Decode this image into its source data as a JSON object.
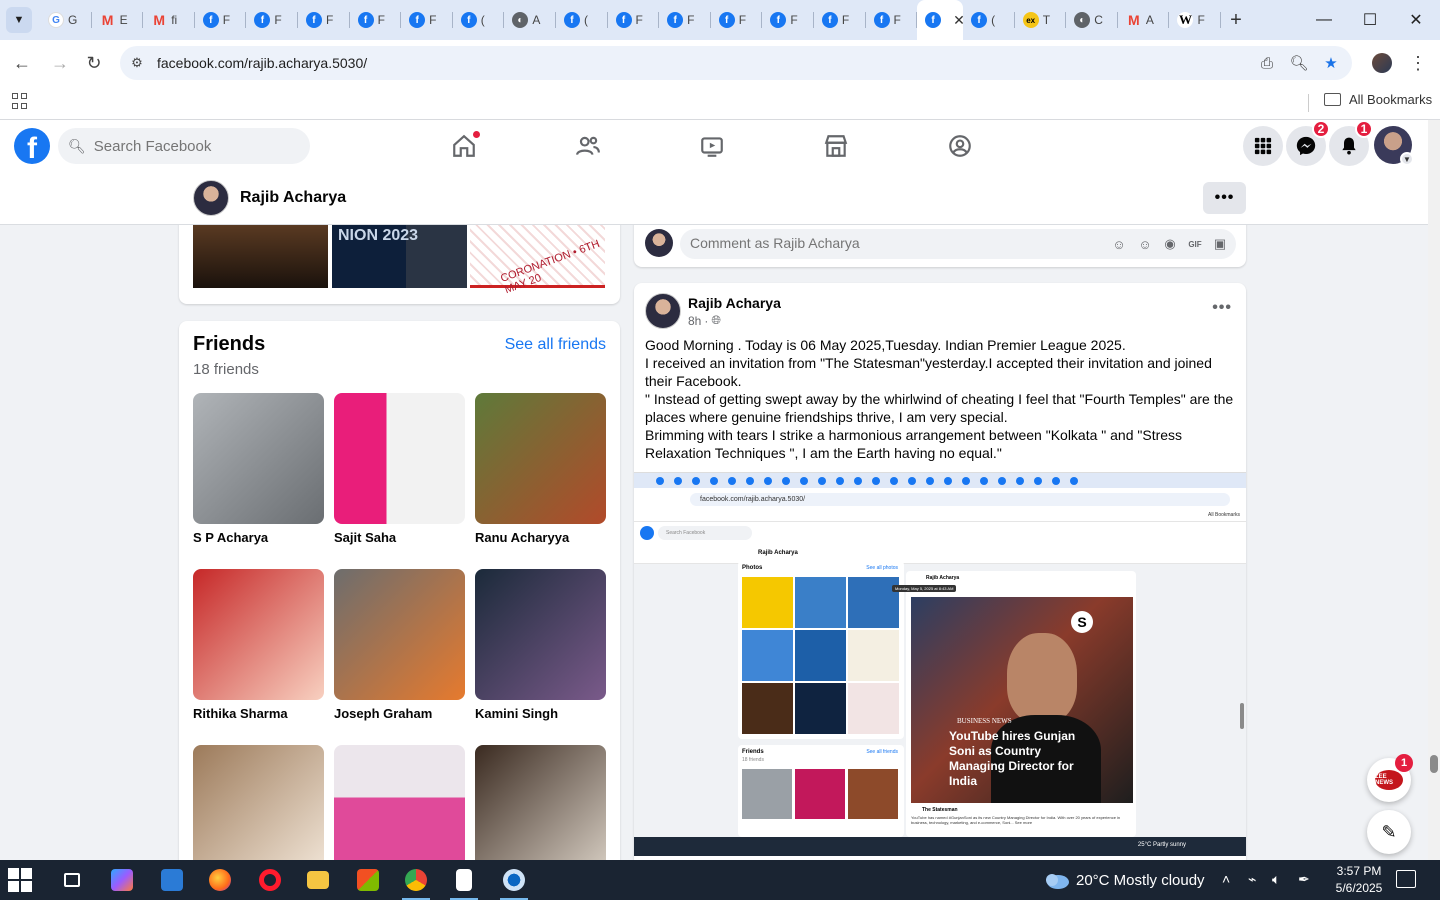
{
  "browser": {
    "tabs": [
      {
        "icon": "google",
        "label": "G"
      },
      {
        "icon": "gmail",
        "label": "E"
      },
      {
        "icon": "gmail",
        "label": "fi"
      },
      {
        "icon": "facebook",
        "label": "F"
      },
      {
        "icon": "facebook",
        "label": "F"
      },
      {
        "icon": "facebook",
        "label": "F"
      },
      {
        "icon": "facebook",
        "label": "F"
      },
      {
        "icon": "facebook",
        "label": "F"
      },
      {
        "icon": "facebook",
        "label": "("
      },
      {
        "icon": "globe",
        "label": "A"
      },
      {
        "icon": "facebook",
        "label": "("
      },
      {
        "icon": "facebook",
        "label": "F"
      },
      {
        "icon": "facebook",
        "label": "F"
      },
      {
        "icon": "facebook",
        "label": "F"
      },
      {
        "icon": "facebook",
        "label": "F"
      },
      {
        "icon": "facebook",
        "label": "F"
      },
      {
        "icon": "facebook",
        "label": "F"
      },
      {
        "icon": "facebook-active",
        "label": "("
      },
      {
        "icon": "facebook",
        "label": "("
      },
      {
        "icon": "ex",
        "label": "T"
      },
      {
        "icon": "globe",
        "label": "C"
      },
      {
        "icon": "gmail",
        "label": "A"
      },
      {
        "icon": "wikipedia",
        "label": "F"
      }
    ],
    "url": "facebook.com/rajib.acharya.5030/",
    "all_bookmarks": "All Bookmarks"
  },
  "fb": {
    "search_placeholder": "Search Facebook",
    "messenger_badge": "2",
    "notifications_badge": "1"
  },
  "profile": {
    "name": "Rajib Acharya"
  },
  "photos": {
    "thumb2_text": "NION 2023",
    "thumb3_text": "CORONATION • 6TH MAY 20"
  },
  "friends": {
    "title": "Friends",
    "count": "18 friends",
    "see_all": "See all friends",
    "list": [
      {
        "name": "S P Acharya"
      },
      {
        "name": "Sajit Saha"
      },
      {
        "name": "Ranu Acharyya"
      },
      {
        "name": "Rithika Sharma"
      },
      {
        "name": "Joseph Graham"
      },
      {
        "name": "Kamini Singh"
      },
      {
        "name": ""
      },
      {
        "name": ""
      },
      {
        "name": ""
      }
    ]
  },
  "comment": {
    "placeholder": "Comment as Rajib Acharya"
  },
  "post": {
    "author": "Rajib Acharya",
    "time": "8h",
    "lines": [
      "Good Morning . Today is 06 May 2025,Tuesday. Indian Premier League 2025.",
      "I received an invitation from \"The Statesman\"yesterday.I accepted their invitation and joined their Facebook.",
      "\" Instead of getting swept away by the whirlwind of cheating I feel that \"Fourth Temples\" are the places where genuine friendships thrive, I am very special.",
      "Brimming with tears I strike a harmonious arrangement between \"Kolkata \" and \"Stress Relaxation Techniques \", I am the Earth having no equal.\""
    ],
    "image": {
      "url": "facebook.com/rajib.acharya.5030/",
      "search": "Search Facebook",
      "profile_name": "Rajib Acharya",
      "photos_label": "Photos",
      "see_all_photos": "See all photos",
      "friends_label": "Friends",
      "friends_count": "18 friends",
      "see_all_friends": "See all friends",
      "post_author": "Rajib Acharya",
      "timestamp_tooltip": "Monday, May 5, 2025 at 8:43 AM",
      "news_tag": "BUSINESS NEWS",
      "news_headline": "YouTube hires Gunjan Soni as Country Managing Director for India",
      "statesman": "The Statesman",
      "caption": "YouTube has named #GunjanSoni as its new Country Managing Director for India. With over 20 years of experience in business, technology, marketing, and e-commerce, Soni... See more",
      "taskbar_weather": "25°C Partly sunny"
    }
  },
  "floating": {
    "zee_label": "ZEE NEWS",
    "zee_badge": "1"
  },
  "taskbar": {
    "weather": "20°C  Mostly cloudy",
    "time": "3:57 PM",
    "date": "5/6/2025"
  },
  "colors": {
    "fb_blue": "#1877f2",
    "badge_red": "#e41e3f",
    "taskbar": "#1a2432"
  }
}
